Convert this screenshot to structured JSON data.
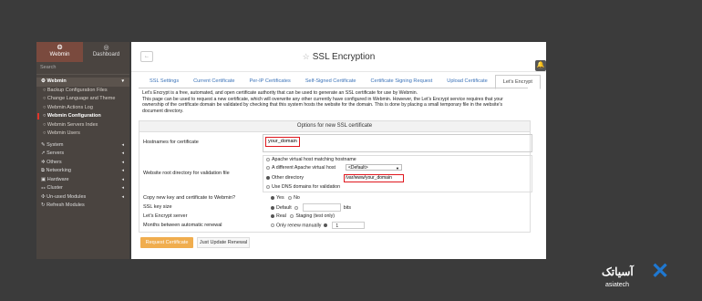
{
  "sidebar": {
    "tabs": [
      {
        "label": "Webmin",
        "icon": "webmin-icon"
      },
      {
        "label": "Dashboard",
        "icon": "dashboard-icon"
      }
    ],
    "search_placeholder": "Search",
    "section_webmin": "Webmin",
    "webmin_items": [
      "Backup Configuration Files",
      "Change Language and Theme",
      "Webmin Actions Log",
      "Webmin Configuration",
      "Webmin Servers Index",
      "Webmin Users"
    ],
    "sections": [
      "System",
      "Servers",
      "Others",
      "Networking",
      "Hardware",
      "Cluster",
      "Un-used Modules",
      "Refresh Modules"
    ]
  },
  "header": {
    "title": "SSL Encryption"
  },
  "tabs": [
    "SSL Settings",
    "Current Certificate",
    "Per-IP Certificates",
    "Self-Signed Certificate",
    "Certificate Signing Request",
    "Upload Certificate",
    "Let's Encrypt"
  ],
  "description": {
    "line1": "Let's Encrypt is a free, automated, and open certificate authority that can be used to generate an SSL certificate for use by Webmin.",
    "line2": "This page can be used to request a new certificate, which will overwrite any other currently have configured in Webmin. However, the Let's Encrypt service requires that your",
    "line3": "ownership of the certificate domain be validated by checking that this system hosts the website for the domain. This is done by placing a small temporary file in the website's",
    "line4": "document directory."
  },
  "form": {
    "panel_title": "Options for new SSL certificate",
    "hostnames_label": "Hostnames for certificate",
    "hostnames_value": "your_domain",
    "webroot_label": "Website root directory for validation file",
    "webroot_options": {
      "matching": "Apache virtual host matching hostname",
      "different": "A different Apache virtual host",
      "different_select": "<Default>",
      "other": "Other directory",
      "other_value": "/var/www/your_domain",
      "dns": "Use DNS domains for validation"
    },
    "copy_label": "Copy new key and certificate to Webmin?",
    "copy_yes": "Yes",
    "copy_no": "No",
    "keysize_label": "SSL key size",
    "keysize_default": "Default",
    "keysize_unit": "bits",
    "server_label": "Let's Encrypt server",
    "server_real": "Real",
    "server_staging": "Staging (test only)",
    "months_label": "Months between automatic renewal",
    "months_manual": "Only renew manually",
    "months_value": "1"
  },
  "buttons": {
    "request": "Request Certificate",
    "update": "Just Update Renewal"
  },
  "watermark": {
    "word": "آسیاتک",
    "sub": "asiatech"
  }
}
